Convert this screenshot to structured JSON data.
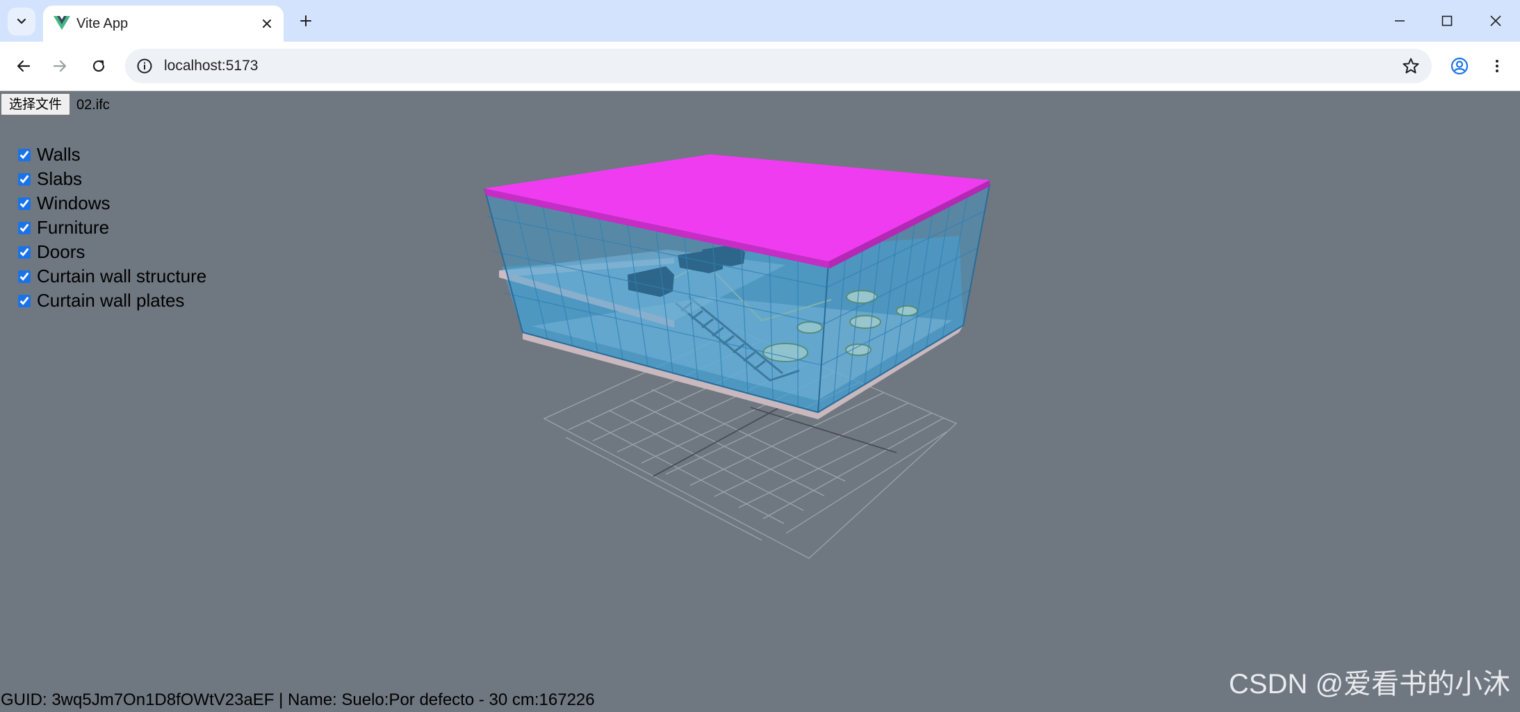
{
  "tabstrip": {
    "tab_title": "Vite App",
    "tab_favicon": "vue-logo-icon",
    "new_tab_icon": "plus-icon",
    "tab_search_icon": "chevron-down-icon"
  },
  "toolbar": {
    "url": "localhost:5173",
    "back_icon": "arrow-left-icon",
    "forward_icon": "arrow-right-icon",
    "reload_icon": "reload-icon",
    "site_info_icon": "info-icon",
    "bookmark_icon": "star-icon",
    "profile_icon": "account-icon",
    "menu_icon": "more-vert-icon"
  },
  "window_controls": [
    "minimize-icon",
    "maximize-icon",
    "close-icon"
  ],
  "file_input": {
    "button_label": "选择文件",
    "file_name": "02.ifc"
  },
  "layers": [
    {
      "label": "Walls",
      "checked": true
    },
    {
      "label": "Slabs",
      "checked": true
    },
    {
      "label": "Windows",
      "checked": true
    },
    {
      "label": "Furniture",
      "checked": true
    },
    {
      "label": "Doors",
      "checked": true
    },
    {
      "label": "Curtain wall structure",
      "checked": true
    },
    {
      "label": "Curtain wall plates",
      "checked": true
    }
  ],
  "status_bar": {
    "text": "GUID: 3wq5Jm7On1D8fOWtV23aEF | Name: Suelo:Por defecto - 30 cm:167226"
  },
  "watermark": "CSDN @爱看书的小沐",
  "colors": {
    "viewport_bg": "#6f7780",
    "tabstrip_bg": "#d3e3fd",
    "highlighted_slab": "#f03cf0",
    "glass": "#3a9fd6"
  }
}
